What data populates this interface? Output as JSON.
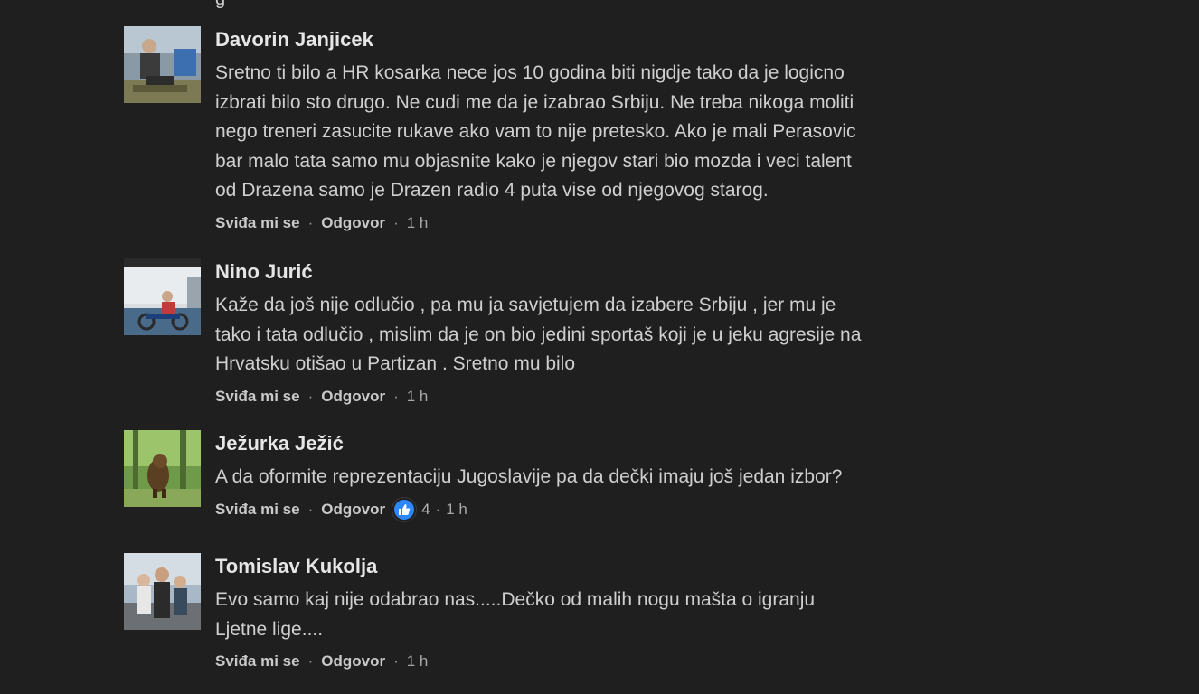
{
  "top_crop_text": "g",
  "comments": [
    {
      "author": "Davorin Janjicek",
      "lines": [
        "Sretno ti bilo a HR kosarka nece jos 10 godina biti nigdje tako da je logicno",
        "izbrati bilo sto drugo. Ne cudi me da je izabrao Srbiju. Ne treba nikoga moliti",
        "nego treneri zasucite rukave ako vam to nije pretesko. Ako je mali Perasovic",
        "bar malo tata samo mu objasnite kako je njegov stari bio mozda i veci talent",
        "od Drazena samo je Drazen radio 4 puta vise od njegovog starog."
      ],
      "like_label": "Sviđa mi se",
      "reply_label": "Odgovor",
      "time": "1 h"
    },
    {
      "author": "Nino Jurić",
      "lines": [
        "Kaže da još nije odlučio , pa mu ja savjetujem da izabere Srbiju , jer mu je",
        "tako i tata odlučio , mislim da je on bio jedini sportaš koji je u jeku agresije na",
        "Hrvatsku otišao u Partizan . Sretno mu bilo"
      ],
      "like_label": "Sviđa mi se",
      "reply_label": "Odgovor",
      "time": "1 h"
    },
    {
      "author": "Ježurka Ježić",
      "lines": [
        "A da oformite reprezentaciju Jugoslavije pa da dečki imaju još jedan izbor?"
      ],
      "like_label": "Sviđa mi se",
      "reply_label": "Odgovor",
      "reaction_icon": "like-icon",
      "reaction_count": "4",
      "time": "1 h"
    },
    {
      "author": "Tomislav Kukolja",
      "lines": [
        "Evo samo kaj nije odabrao nas.....Dečko od malih nogu mašta o igranju",
        "Ljetne lige...."
      ],
      "like_label": "Sviđa mi se",
      "reply_label": "Odgovor",
      "time": "1 h"
    }
  ],
  "colors": {
    "background": "#1f1f1f",
    "reaction_blue": "#2d88ff"
  }
}
